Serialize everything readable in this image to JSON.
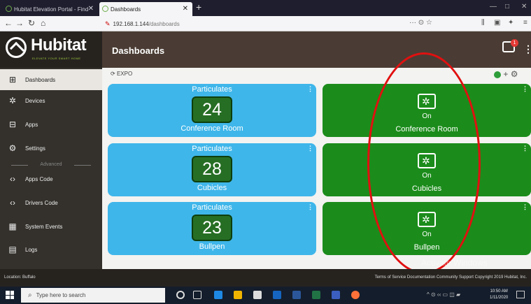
{
  "browser": {
    "tabs": [
      {
        "label": "Hubitat Elevation Portal - Find"
      },
      {
        "label": "Dashboards"
      }
    ],
    "new_tab": "+",
    "url_host": "192.168.1.144",
    "url_path": "/dashboards",
    "url_extra": "··· ⊙ ☆"
  },
  "app": {
    "logo_text": "Hubitat",
    "logo_tag": "ELEVATE YOUR SMART HOME",
    "header_title": "Dashboards",
    "notification_count": "1"
  },
  "sidebar": {
    "items": [
      {
        "label": "Dashboards",
        "icon": "dashboard-icon"
      },
      {
        "label": "Devices",
        "icon": "devices-icon"
      },
      {
        "label": "Apps",
        "icon": "apps-icon"
      },
      {
        "label": "Settings",
        "icon": "settings-icon"
      },
      {
        "label": "Apps Code",
        "icon": "code-icon"
      },
      {
        "label": "Drivers Code",
        "icon": "code-icon"
      },
      {
        "label": "System Events",
        "icon": "events-icon"
      },
      {
        "label": "Logs",
        "icon": "logs-icon"
      }
    ],
    "advanced_label": "Advanced"
  },
  "dashboard": {
    "name": "EXPO",
    "tiles": [
      {
        "header": "Particulates",
        "value": "24",
        "footer": "Conference Room"
      },
      {
        "header": "Particulates",
        "value": "28",
        "footer": "Cubicles"
      },
      {
        "header": "Particulates",
        "value": "23",
        "footer": "Bullpen"
      }
    ],
    "switches": [
      {
        "state": "On",
        "device": "Conference Room"
      },
      {
        "state": "On",
        "device": "Cubicles"
      },
      {
        "state": "On",
        "device": "Bullpen"
      }
    ]
  },
  "footer": {
    "location": "Location: Buffalo",
    "links": "Terms of Service  Documentation  Community  Support  Copyright 2019 Hubitat, Inc."
  },
  "watermark": "Activate Windows",
  "taskbar": {
    "search_placeholder": "Type here to search",
    "time": "10:50 AM",
    "date": "1/11/2020"
  },
  "colors": {
    "tile_blue": "#3fb6ea",
    "tile_green": "#1b8c1b",
    "header_brown": "#4a3c34",
    "annotation_red": "#e11010"
  }
}
